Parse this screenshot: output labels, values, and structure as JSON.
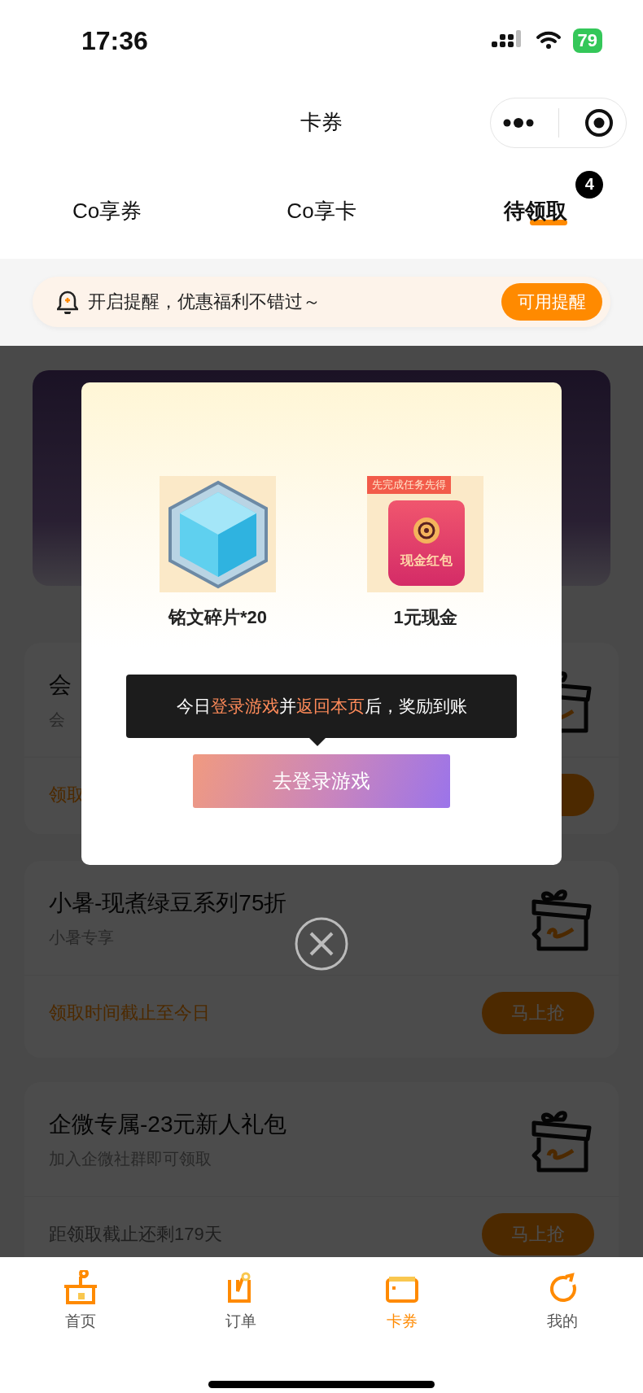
{
  "status_bar": {
    "time": "17:36",
    "battery": "79"
  },
  "nav": {
    "title": "卡券"
  },
  "tabs": [
    {
      "label": "Co享券",
      "selected": false
    },
    {
      "label": "Co享卡",
      "selected": false
    },
    {
      "label": "待领取",
      "selected": true,
      "badge": "4"
    }
  ],
  "reminder": {
    "text": "开启提醒，优惠福利不错过～",
    "button": "可用提醒"
  },
  "cards": [
    {
      "title": "会",
      "subtitle": "会",
      "footer": "领取",
      "urgent": true
    },
    {
      "title": "小暑-现煮绿豆系列75折",
      "subtitle": "小暑专享",
      "footer": "领取时间截止至今日",
      "urgent": true,
      "button": "马上抢"
    },
    {
      "title": "企微专属-23元新人礼包",
      "subtitle": "加入企微社群即可领取",
      "footer": "距领取截止还剩179天",
      "urgent": false,
      "button": "马上抢"
    }
  ],
  "modal": {
    "rewards": [
      {
        "kind": "crystal",
        "label": "铭文碎片*20"
      },
      {
        "kind": "red_packet",
        "ribbon": "先完成任务先得",
        "packet_text": "现金红包",
        "label": "1元现金"
      }
    ],
    "tooltip": [
      {
        "text": "今日",
        "highlight": false
      },
      {
        "text": "登录游戏",
        "highlight": true
      },
      {
        "text": "并",
        "highlight": false
      },
      {
        "text": "返回本页",
        "highlight": true
      },
      {
        "text": "后，奖励到账",
        "highlight": false
      }
    ],
    "button": "去登录游戏"
  },
  "bottom_nav": [
    {
      "label": "首页",
      "selected": false
    },
    {
      "label": "订单",
      "selected": false
    },
    {
      "label": "卡券",
      "selected": true
    },
    {
      "label": "我的",
      "selected": false
    }
  ]
}
